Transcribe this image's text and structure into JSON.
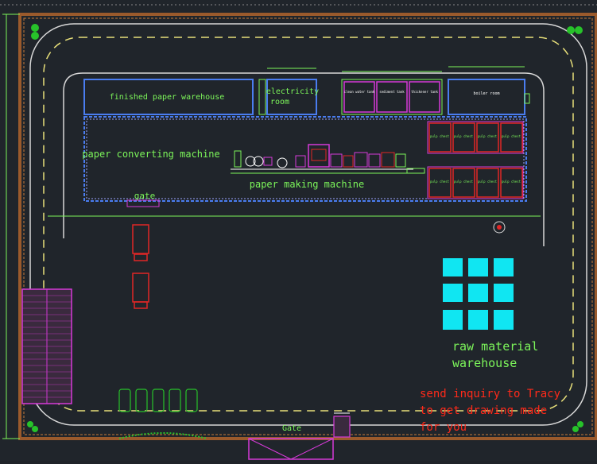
{
  "labels": {
    "finished_warehouse": "finished paper warehouse",
    "electricity_room_line1": "electricity",
    "electricity_room_line2": "room",
    "paper_converting": "paper converting machine",
    "paper_making": "paper making machine",
    "gate_top": "gate",
    "gate_bottom": "Gate",
    "boiler_room": "boiler room",
    "tank_1": "clean water tank",
    "tank_2": "sediment tank",
    "tank_3": "thickener tank",
    "pulp_label": "pulp chest",
    "raw_material_line1": "raw material",
    "raw_material_line2": "warehouse",
    "inquiry_line1": "send inquiry to Tracy",
    "inquiry_line2": "to get drawing made",
    "inquiry_line3": "for you"
  },
  "colors": {
    "background": "#20252b",
    "outer_wall": "#9a5a2c",
    "label_green": "#7cf55a",
    "building_blue": "#4a7df0",
    "line_white": "#d8d8d8",
    "road_yellow": "#e8e07a",
    "magenta": "#d63ad8",
    "red": "#e02626",
    "cyan": "#10e6f2",
    "inquiry_red": "#ff2a1a"
  }
}
